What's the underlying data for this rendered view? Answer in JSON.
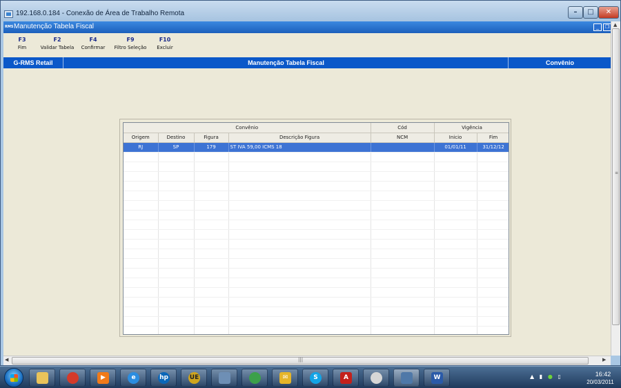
{
  "rdp": {
    "title": "192.168.0.184 - Conexão de Área de Trabalho Remota"
  },
  "app": {
    "title": "Manutenção Tabela Fiscal",
    "icon_label": "RMS"
  },
  "fkeys": [
    {
      "key": "F3",
      "label": "Fim"
    },
    {
      "key": "F2",
      "label": "Validar Tabela"
    },
    {
      "key": "F4",
      "label": "Confirmar"
    },
    {
      "key": "F9",
      "label": "Filtro Seleção"
    },
    {
      "key": "F10",
      "label": "Excluir"
    }
  ],
  "band": {
    "left": "G-RMS Retail",
    "center": "Manutenção Tabela Fiscal",
    "right": "Convênio"
  },
  "grid": {
    "group_headers": {
      "convenio": "Convênio",
      "cod": "Cód",
      "vigencia": "Vigência"
    },
    "columns": [
      "Origem",
      "Destino",
      "Figura",
      "Descrição Figura",
      "NCM",
      "Inicio",
      "Fim"
    ],
    "rows": [
      {
        "origem": "RJ",
        "destino": "SP",
        "figura": "179",
        "descricao": "ST IVA 59,00 ICMS 18",
        "ncm": "",
        "inicio": "01/01/11",
        "fim": "31/12/12"
      }
    ]
  },
  "taskbar": {
    "time": "16:42",
    "date": "20/03/2011"
  },
  "colors": {
    "band_blue": "#0b58c9",
    "selected_row": "#3d73d4",
    "app_background": "#ece9d8"
  }
}
